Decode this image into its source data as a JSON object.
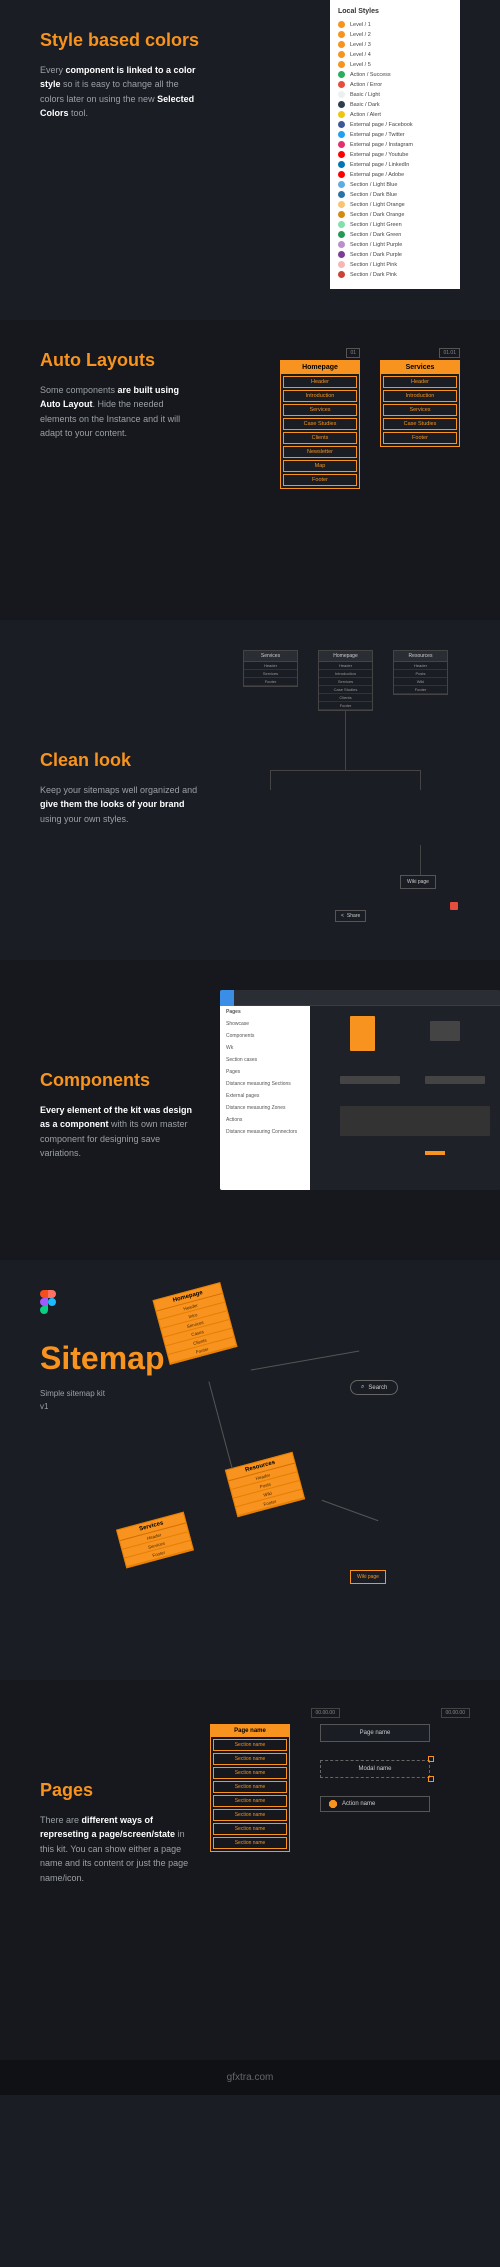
{
  "styles": {
    "title": "Style based colors",
    "body_a": "Every ",
    "body_b": "component is linked to a color style",
    "body_c": " so it is easy to change all the colors later on using the new ",
    "body_d": "Selected Colors",
    "body_e": " tool.",
    "panel_title": "Local Styles",
    "items": [
      {
        "label": "Level / 1",
        "color": "#f7931e"
      },
      {
        "label": "Level / 2",
        "color": "#f7931e"
      },
      {
        "label": "Level / 3",
        "color": "#f7931e"
      },
      {
        "label": "Level / 4",
        "color": "#f7931e"
      },
      {
        "label": "Level / 5",
        "color": "#f7931e"
      },
      {
        "label": "Action / Success",
        "color": "#27ae60"
      },
      {
        "label": "Action / Error",
        "color": "#e74c3c"
      },
      {
        "label": "Basic / Light",
        "color": "#ecf0f1"
      },
      {
        "label": "Basic / Dark",
        "color": "#2c3e50"
      },
      {
        "label": "Action / Alert",
        "color": "#f1c40f"
      },
      {
        "label": "External page / Facebook",
        "color": "#3b5998"
      },
      {
        "label": "External page / Twitter",
        "color": "#1da1f2"
      },
      {
        "label": "External page / Instagram",
        "color": "#e1306c"
      },
      {
        "label": "External page / Youtube",
        "color": "#ff0000"
      },
      {
        "label": "External page / LinkedIn",
        "color": "#0077b5"
      },
      {
        "label": "External page / Adobe",
        "color": "#ff0000"
      },
      {
        "label": "Section / Light Blue",
        "color": "#5dade2"
      },
      {
        "label": "Section / Dark Blue",
        "color": "#2874a6"
      },
      {
        "label": "Section / Light Orange",
        "color": "#f8c471"
      },
      {
        "label": "Section / Dark Orange",
        "color": "#d68910"
      },
      {
        "label": "Section / Light Green",
        "color": "#82e0aa"
      },
      {
        "label": "Section / Dark Green",
        "color": "#239b56"
      },
      {
        "label": "Section / Light Purple",
        "color": "#bb8fce"
      },
      {
        "label": "Section / Dark Purple",
        "color": "#7d3c98"
      },
      {
        "label": "Section / Light Pink",
        "color": "#f5b7b1"
      },
      {
        "label": "Section / Dark Pink",
        "color": "#cb4335"
      }
    ]
  },
  "auto": {
    "title": "Auto Layouts",
    "body_a": "Some components ",
    "body_b": "are built using Auto Layout",
    "body_c": ". Hide the needed elements on the Instance and it will adapt to your content.",
    "tag1": "01",
    "tag2": "01.01",
    "card1": {
      "title": "Homepage",
      "rows": [
        "Header",
        "Introduction",
        "Services",
        "Case Studies",
        "Clients",
        "Newsletter",
        "Map",
        "Footer"
      ]
    },
    "card2": {
      "title": "Services",
      "rows": [
        "Header",
        "Introduction",
        "Services",
        "Case Studies",
        "Footer"
      ]
    }
  },
  "clean": {
    "title": "Clean look",
    "body_a": "Keep your sitemaps well organized and ",
    "body_b": "give them the looks of your brand",
    "body_c": " using your own styles.",
    "homepage": {
      "title": "Homepage",
      "rows": [
        "Header",
        "Introduction",
        "Services",
        "Case Studies",
        "Clients",
        "Footer"
      ]
    },
    "services": {
      "title": "Services",
      "rows": [
        "Header",
        "Services",
        "Footer"
      ]
    },
    "resources": {
      "title": "Resources",
      "rows": [
        "Header",
        "Posts",
        "Wiki",
        "Footer"
      ]
    },
    "wiki": "Wiki page",
    "share": "Share"
  },
  "components": {
    "title": "Components",
    "body_a": "Every element of the kit was design as a component",
    "body_b": " with its own master component for designing save variations.",
    "pages_label": "Pages",
    "side_items": [
      "Showcase",
      "Components",
      "Wk",
      "Section cases",
      "Pages",
      "Distance measuring Sections",
      "External pages",
      "Distance measuring Zones",
      "Actions",
      "Distance measuring Connectors"
    ]
  },
  "sitemap": {
    "title": "Sitemap",
    "sub1": "Simple sitemap kit",
    "sub2": "v1",
    "search": "Search",
    "homepage": {
      "title": "Homepage",
      "rows": [
        "Header",
        "Intro",
        "Services",
        "Cases",
        "Clients",
        "Footer"
      ]
    },
    "resources": {
      "title": "Resources",
      "rows": [
        "Header",
        "Posts",
        "Wiki",
        "Footer"
      ]
    },
    "services": {
      "title": "Services",
      "rows": [
        "Header",
        "Services",
        "Footer"
      ]
    },
    "wiki": "Wiki page"
  },
  "pages": {
    "title": "Pages",
    "body_a": "There are ",
    "body_b": "different ways of represeting a page/screen/state",
    "body_c": " in this kit. You can show either a page name and its content or just the page name/icon.",
    "time1": "00.00.00",
    "time2": "00.00.00",
    "card": {
      "title": "Page name",
      "rows": [
        "Section name",
        "Section name",
        "Section name",
        "Section name",
        "Section name",
        "Section name",
        "Section name",
        "Section name"
      ]
    },
    "pagebox": "Page name",
    "modal": "Modal name",
    "action": "Action name"
  },
  "watermark": "gfxtra.com"
}
